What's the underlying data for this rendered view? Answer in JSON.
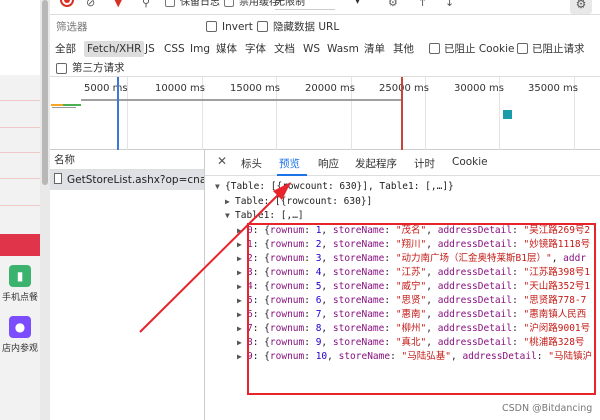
{
  "site": {
    "items": [
      {
        "label": "手机点餐",
        "icon": "phone-icon",
        "color": "#3bb36e"
      },
      {
        "label": "店内参观",
        "icon": "group-icon",
        "color": "#7c4dff"
      }
    ],
    "accent": "#e0344a"
  },
  "toolbar": {
    "preserve_log": "保留日志",
    "disable_cache": "禁用缓存",
    "throttle": "无限制",
    "throttle_caret": "▾"
  },
  "filter": {
    "placeholder": "筛选器",
    "invert": "Invert",
    "hide_data_urls": "隐藏数据 URL"
  },
  "types": [
    "全部",
    "Fetch/XHR",
    "JS",
    "CSS",
    "Img",
    "媒体",
    "字体",
    "文档",
    "WS",
    "Wasm",
    "清单",
    "其他"
  ],
  "blocked_cookies": "已阻止 Cookie",
  "blocked_requests": "已阻止请求",
  "third_party": "第三方请求",
  "timeline": {
    "ticks": [
      "5000 ms",
      "10000 ms",
      "15000 ms",
      "20000 ms",
      "25000 ms",
      "30000 ms",
      "35000 ms"
    ]
  },
  "requests": {
    "header": "名称",
    "rows": [
      "GetStoreList.ashx?op=cname"
    ]
  },
  "detail": {
    "tabs": [
      "标头",
      "预览",
      "响应",
      "发起程序",
      "计时",
      "Cookie"
    ],
    "active_tab": "预览"
  },
  "tree": {
    "root": "{Table: [{rowcount: 630}], Table1: [,…]}",
    "table": "Table: [{rowcount: 630}]",
    "table1": "Table1: [,…]",
    "rows": [
      {
        "i": "0",
        "rownum": "1",
        "storeName": "\"茂名\"",
        "address": "\"吴江路269号2"
      },
      {
        "i": "1",
        "rownum": "2",
        "storeName": "\"翔川\"",
        "address": "\"妙镜路1118号"
      },
      {
        "i": "2",
        "rownum": "3",
        "storeName": "\"动力南广场（汇金奥特莱斯B1层）\"",
        "address": "addr"
      },
      {
        "i": "3",
        "rownum": "4",
        "storeName": "\"江苏\"",
        "address": "\"江苏路398号1"
      },
      {
        "i": "4",
        "rownum": "5",
        "storeName": "\"威宁\"",
        "address": "\"天山路352号1"
      },
      {
        "i": "5",
        "rownum": "6",
        "storeName": "\"思贤\"",
        "address": "\"思贤路778-7"
      },
      {
        "i": "6",
        "rownum": "7",
        "storeName": "\"惠南\"",
        "address": "\"惠南镇人民西"
      },
      {
        "i": "7",
        "rownum": "8",
        "storeName": "\"柳州\"",
        "address": "\"沪闵路9001号"
      },
      {
        "i": "8",
        "rownum": "9",
        "storeName": "\"真北\"",
        "address": "\"桃浦路328号"
      },
      {
        "i": "9",
        "rownum": "10",
        "storeName": "\"马陆弘基\"",
        "address": "\"马陆镇沪"
      }
    ]
  },
  "watermark": "CSDN @Bitdancing",
  "colors": {
    "annotation": "#e8232b",
    "devtools_blue": "#1a73e8",
    "record_red": "#d93025"
  }
}
